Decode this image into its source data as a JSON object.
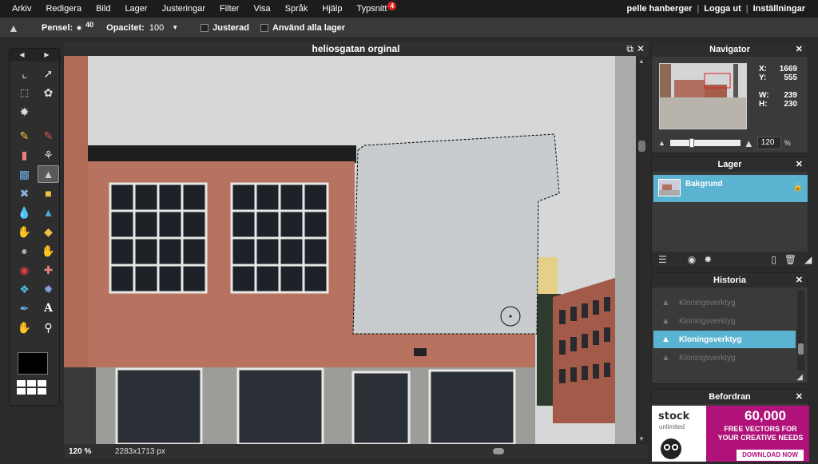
{
  "menu": [
    "Arkiv",
    "Redigera",
    "Bild",
    "Lager",
    "Justeringar",
    "Filter",
    "Visa",
    "Språk",
    "Hjälp",
    "Typsnitt"
  ],
  "menu_badge": "4",
  "user": {
    "name": "pelle hanberger",
    "sep": "|",
    "logout": "Logga ut",
    "settings": "Inställningar"
  },
  "options": {
    "brush_label": "Pensel:",
    "brush_size": "40",
    "opacity_label": "Opacitet:",
    "opacity_value": "100",
    "aligned_label": "Justerad",
    "all_layers_label": "Använd alla lager"
  },
  "canvas": {
    "title": "heliosgatan orginal",
    "zoom": "120",
    "zoom_unit": "%",
    "dimensions": "2283x1713 px"
  },
  "navigator": {
    "title": "Navigator",
    "x_label": "X:",
    "x_value": "1669",
    "y_label": "Y:",
    "y_value": "555",
    "w_label": "W:",
    "w_value": "239",
    "h_label": "H:",
    "h_value": "230",
    "zoom": "120",
    "zoom_unit": "%"
  },
  "layers": {
    "title": "Lager",
    "items": [
      {
        "name": "Bakgrund"
      }
    ]
  },
  "history": {
    "title": "Historia",
    "items": [
      "Kloningsverktyg",
      "Kloningsverktyg",
      "Kloningsverktyg",
      "Kloningsverktyg"
    ],
    "selected_index": 2
  },
  "ads": {
    "title": "Befordran",
    "brand": "stock",
    "brand_sub": "unlimited",
    "headline": "60,000",
    "sub1": "FREE VECTORS FOR",
    "sub2": "YOUR CREATIVE NEEDS",
    "button": "DOWNLOAD NOW"
  },
  "colors": {
    "accent": "#5ab4d1",
    "primary_color": "#000000"
  }
}
